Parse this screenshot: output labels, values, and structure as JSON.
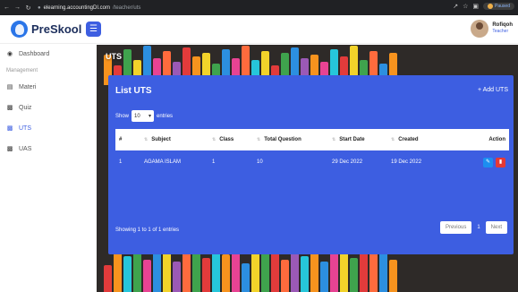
{
  "browser": {
    "url_host": "elearning.accountingDI.com",
    "url_path": "/teacher/uts",
    "paused_label": "Paused"
  },
  "header": {
    "app_name": "PreSkool",
    "user_name": "Rofiqoh",
    "user_role": "Teacher"
  },
  "sidebar": {
    "items": [
      {
        "label": "Dashboard",
        "icon": "dashboard-icon"
      },
      {
        "label": "Materi",
        "icon": "book-icon"
      },
      {
        "label": "Quiz",
        "icon": "clipboard-icon"
      },
      {
        "label": "UTS",
        "icon": "clipboard-icon"
      },
      {
        "label": "UAS",
        "icon": "clipboard-icon"
      }
    ],
    "section_label": "Management"
  },
  "page": {
    "title": "UTS",
    "card_title": "List UTS",
    "add_label": "+ Add UTS",
    "show_label": "Show",
    "entries_value": "10",
    "entries_label": "entries",
    "info": "Showing 1 to 1 of 1 entries",
    "prev_label": "Previous",
    "page_number": "1",
    "next_label": "Next"
  },
  "table": {
    "columns": [
      "#",
      "Subject",
      "Class",
      "Total Question",
      "Start Date",
      "Created",
      "Action"
    ],
    "rows": [
      {
        "no": "1",
        "subject": "AGAMA ISLAM",
        "class": "1",
        "total_question": "10",
        "start_date": "29 Dec 2022",
        "created": "19 Dec 2022"
      }
    ]
  },
  "colors": {
    "primary": "#3d5ee1",
    "edit": "#1c8ef0",
    "delete": "#e53935"
  }
}
